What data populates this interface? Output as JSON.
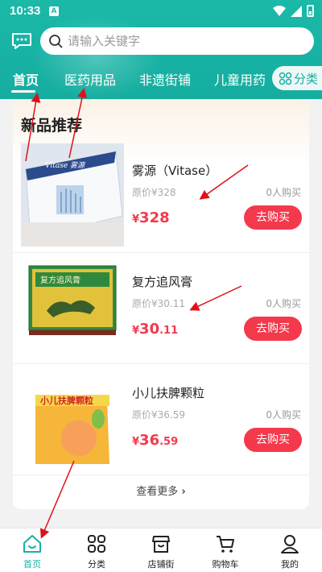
{
  "status": {
    "time": "10:33",
    "sim_label": "A"
  },
  "search": {
    "placeholder": "请输入关键字"
  },
  "tabs": [
    {
      "label": "首页"
    },
    {
      "label": "医药用品"
    },
    {
      "label": "非遗街铺"
    },
    {
      "label": "儿童用药"
    }
  ],
  "category_button": {
    "label": "分类",
    "icon": "grid-icon"
  },
  "section": {
    "title": "新品推荐",
    "more_label": "查看更多"
  },
  "products": [
    {
      "name": "雾源（Vitase）",
      "original_price": "原价¥328",
      "sold": "0人购买",
      "currency": "¥",
      "price_int": "328",
      "price_dec": "",
      "buy_label": "去购买",
      "box_text": "Vitase 雾源"
    },
    {
      "name": "复方追风膏",
      "original_price": "原价¥30.11",
      "sold": "0人购买",
      "currency": "¥",
      "price_int": "30",
      "price_dec": ".11",
      "buy_label": "去购买",
      "box_text": "复方追风膏"
    },
    {
      "name": "小儿扶脾颗粒",
      "original_price": "原价¥36.59",
      "sold": "0人购买",
      "currency": "¥",
      "price_int": "36",
      "price_dec": ".59",
      "buy_label": "去购买",
      "box_text": "小儿扶脾颗粒"
    }
  ],
  "tabbar": [
    {
      "label": "首页",
      "icon": "home-icon",
      "active": true
    },
    {
      "label": "分类",
      "icon": "grid-icon",
      "active": false
    },
    {
      "label": "店铺街",
      "icon": "store-icon",
      "active": false
    },
    {
      "label": "购物车",
      "icon": "cart-icon",
      "active": false
    },
    {
      "label": "我的",
      "icon": "user-icon",
      "active": false
    }
  ],
  "colors": {
    "brand": "#17b2a4",
    "price": "#f23a4c",
    "buy_button": "#f4394d",
    "annotation_arrow": "#e0101b"
  }
}
